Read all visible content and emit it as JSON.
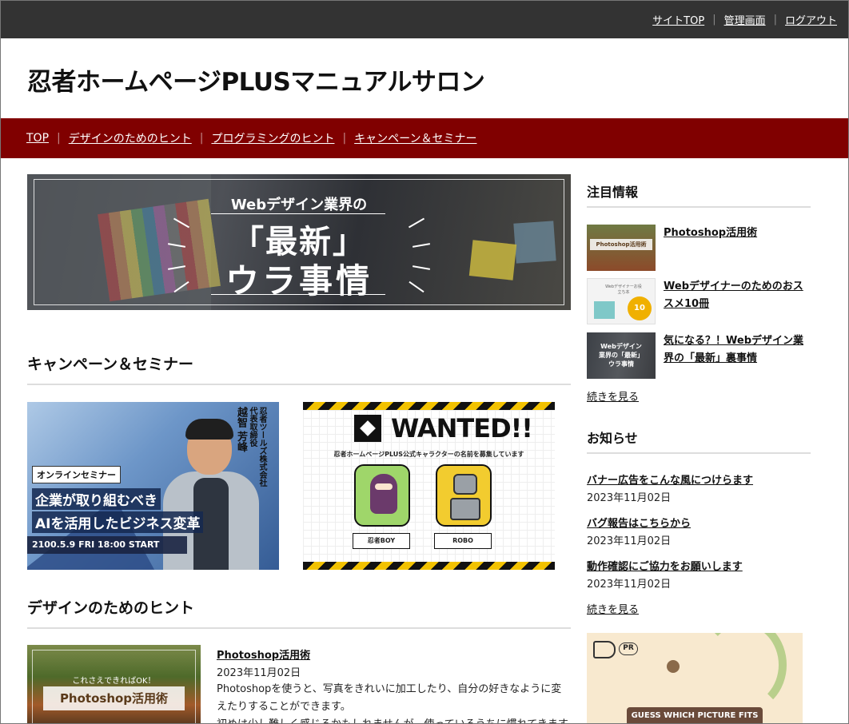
{
  "topbar": {
    "links": [
      "サイトTOP",
      "管理画面",
      "ログアウト"
    ],
    "separator": "|"
  },
  "site": {
    "title": "忍者ホームページPLUSマニュアルサロン"
  },
  "nav": {
    "items": [
      "TOP",
      "デザインのためのヒント",
      "プログラミングのヒント",
      "キャンペーン＆セミナー"
    ],
    "separator": "|"
  },
  "hero": {
    "line1": "Webデザイン業界の",
    "line2": "「最新」",
    "line3": "ウラ事情"
  },
  "campaign": {
    "title": "キャンペーン＆セミナー",
    "seminar": {
      "badge": "オンラインセミナー",
      "headline1": "企業が取り組むべき",
      "headline2": "AIを活用したビジネス変革",
      "date": "2100.5.9 FRI 18:00 START",
      "company": "忍者ツールズ株式会社",
      "role": "代表取締役",
      "name": "越智 芳峰"
    },
    "wanted": {
      "title": "WANTED!!",
      "subtitle": "忍者ホームページPLUS公式キャラクターの名前を募集しています",
      "char1": "忍者BOY",
      "char2": "ROBO"
    }
  },
  "design": {
    "title": "デザインのためのヒント",
    "post": {
      "thumb_small": "これさえできればOK！",
      "thumb_big": "Photoshop活用術",
      "title": "Photoshop活用術",
      "date": "2023年11月02日",
      "line1": "Photoshopを使うと、写真をきれいに加工したり、自分の好きなように変",
      "line2": "えたりすることができます。",
      "line3": "初めは少し難しく感じるかもしれませんが、使っているうちに慣れてきます"
    }
  },
  "sidebar": {
    "featured_title": "注目情報",
    "featured": [
      {
        "label": "Photoshop活用術",
        "thumb_text": "Photoshop活用術"
      },
      {
        "label": "Webデザイナーのためのおススメ10冊",
        "thumb_text": "Webデザイナーお役立ち本",
        "badge": "10"
      },
      {
        "label": "気になる？！Webデザイン業界の「最新」裏事情",
        "thumb_text": "Webデザイン業界の「最新」ウラ事情"
      }
    ],
    "more1": "続きを見る",
    "news_title": "お知らせ",
    "news": [
      {
        "title": "バナー広告をこんな風につけらます",
        "date": "2023年11月02日"
      },
      {
        "title": "バグ報告はこちらから",
        "date": "2023年11月02日"
      },
      {
        "title": "動作確認にご協力をお願いします",
        "date": "2023年11月02日"
      }
    ],
    "more2": "続きを見る",
    "ad": {
      "pr": "PR",
      "text": "GUESS WHICH PICTURE FITS"
    }
  }
}
